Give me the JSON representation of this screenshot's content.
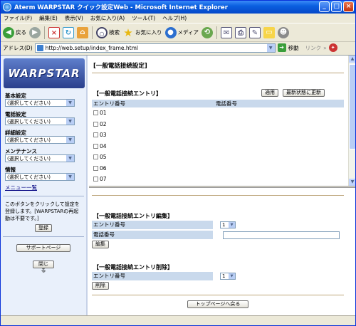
{
  "window": {
    "title": "Aterm WARPSTAR クイック設定Web - Microsoft Internet Explorer"
  },
  "menu": [
    "ファイル(F)",
    "編集(E)",
    "表示(V)",
    "お気に入り(A)",
    "ツール(T)",
    "ヘルプ(H)"
  ],
  "toolbar": {
    "back": "戻る",
    "search": "検索",
    "favorites": "お気に入り",
    "media": "メディア"
  },
  "address": {
    "label": "アドレス(D)",
    "url": "http://web.setup/index_frame.html",
    "go": "移動",
    "links": "リンク"
  },
  "sidebar": {
    "logo": "WARPSTAR",
    "sections": [
      {
        "label": "基本設定",
        "value": "(選択してください)"
      },
      {
        "label": "電話設定",
        "value": "(選択してください)"
      },
      {
        "label": "詳細設定",
        "value": "(選択してください)"
      },
      {
        "label": "メンテナンス",
        "value": "(選択してください)"
      },
      {
        "label": "情報",
        "value": "(選択してください)"
      }
    ],
    "menu_list": "メニュー一覧",
    "note": "このボタンをクリックして設定を登録します。[WARPSTARの再起動は不要です。]",
    "register": "登録",
    "support": "サポートページ",
    "close": "閉じる"
  },
  "top_frame": {
    "page_title": "[一般電話接続設定]",
    "section_title": "【一般電話接続エントリ】",
    "apply": "適用",
    "refresh": "最新状態に更新",
    "col_entry": "エントリ番号",
    "col_phone": "電話番号",
    "rows": [
      "01",
      "02",
      "03",
      "04",
      "05",
      "06",
      "07"
    ]
  },
  "bottom_frame": {
    "edit_title": "【一般電話接続エントリ編集】",
    "entry_label": "エントリ番号",
    "entry_value": "1",
    "phone_label": "電話番号",
    "phone_value": "",
    "edit_button": "編集",
    "delete_title": "【一般電話接続エントリ削除】",
    "delete_entry_label": "エントリ番号",
    "delete_entry_value": "1",
    "delete_button": "削除",
    "top_page": "トップページへ戻る"
  }
}
